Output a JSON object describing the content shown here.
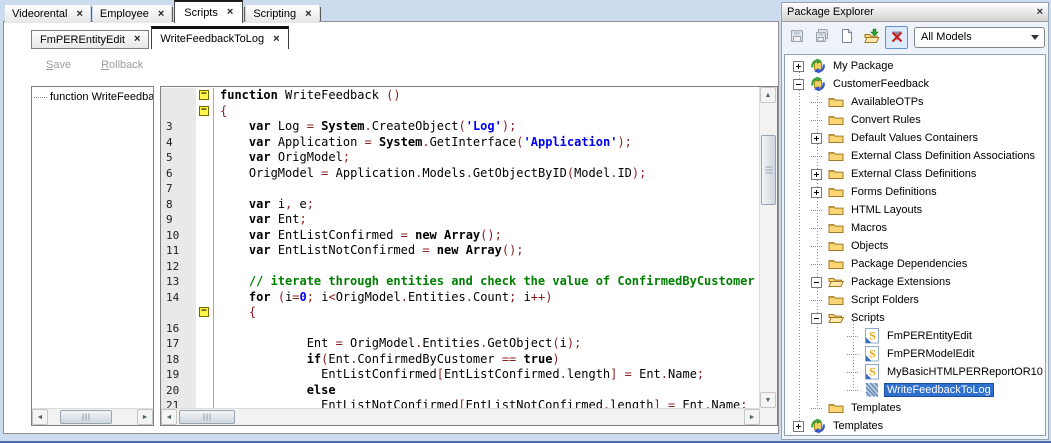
{
  "colors": {
    "selection_bg": "#2f6fce",
    "string": "#0000ee",
    "comment": "#008000",
    "symbol": "#8b2020",
    "number": "#0000ee"
  },
  "document_tabs": [
    {
      "label": "Videorental",
      "close": "×",
      "active": false
    },
    {
      "label": "Employee",
      "close": "×",
      "active": false
    },
    {
      "label": "Scripts",
      "close": "×",
      "active": true
    },
    {
      "label": "Scripting",
      "close": "×",
      "active": false
    }
  ],
  "editor_tabs": [
    {
      "label": "FmPEREntityEdit",
      "close": "×",
      "active": false
    },
    {
      "label": "WriteFeedbackToLog",
      "close": "×",
      "active": true
    }
  ],
  "toolbar": {
    "save_label": "Save",
    "rollback_label": "Rollback"
  },
  "outline": {
    "items": [
      {
        "label": "function WriteFeedback"
      }
    ]
  },
  "code_editor": {
    "lines": [
      {
        "num": "",
        "fold": "minus",
        "text": "function WriteFeedback ()"
      },
      {
        "num": "",
        "fold": "minus",
        "text": "{"
      },
      {
        "num": "3",
        "fold": "",
        "text": "    var Log = System.CreateObject('Log');"
      },
      {
        "num": "4",
        "fold": "",
        "text": "    var Application = System.GetInterface('Application');"
      },
      {
        "num": "5",
        "fold": "",
        "text": "    var OrigModel;"
      },
      {
        "num": "6",
        "fold": "",
        "text": "    OrigModel = Application.Models.GetObjectByID(Model.ID);"
      },
      {
        "num": "7",
        "fold": "",
        "text": ""
      },
      {
        "num": "8",
        "fold": "",
        "text": "    var i, e;"
      },
      {
        "num": "9",
        "fold": "",
        "text": "    var Ent;"
      },
      {
        "num": "10",
        "fold": "",
        "text": "    var EntListConfirmed = new Array();"
      },
      {
        "num": "11",
        "fold": "",
        "text": "    var EntListNotConfirmed = new Array();"
      },
      {
        "num": "12",
        "fold": "",
        "text": ""
      },
      {
        "num": "13",
        "fold": "",
        "text": "    // iterate through entities and check the value of ConfirmedByCustomer"
      },
      {
        "num": "14",
        "fold": "",
        "text": "    for (i=0; i<OrigModel.Entities.Count; i++)"
      },
      {
        "num": "",
        "fold": "minus",
        "text": "    {"
      },
      {
        "num": "16",
        "fold": "",
        "text": ""
      },
      {
        "num": "17",
        "fold": "",
        "text": "            Ent = OrigModel.Entities.GetObject(i);"
      },
      {
        "num": "18",
        "fold": "",
        "text": "            if(Ent.ConfirmedByCustomer == true)"
      },
      {
        "num": "19",
        "fold": "",
        "text": "              EntListConfirmed[EntListConfirmed.length] = Ent.Name;"
      },
      {
        "num": "20",
        "fold": "",
        "text": "            else"
      },
      {
        "num": "21",
        "fold": "",
        "text": "              EntListNotConfirmed[EntListNotConfirmed.length] = Ent.Name;"
      }
    ]
  },
  "package_explorer": {
    "title": "Package Explorer",
    "close": "×",
    "toolbar": {
      "buttons": [
        {
          "icon": "save",
          "name": "save-icon",
          "disabled": true,
          "pressed": false
        },
        {
          "icon": "save-all",
          "name": "save-all-icon",
          "disabled": true,
          "pressed": false
        },
        {
          "icon": "new-document",
          "name": "new-document-icon",
          "disabled": false,
          "pressed": false
        },
        {
          "icon": "open-package",
          "name": "open-package-icon",
          "disabled": false,
          "pressed": false
        },
        {
          "icon": "filter-disabled",
          "name": "filter-disabled-icon",
          "disabled": false,
          "pressed": true
        }
      ],
      "model_filter": {
        "value": "All Models"
      }
    },
    "tree": [
      {
        "label": "My Package",
        "icon": "package",
        "level": 0,
        "expander": "plus",
        "selected": false
      },
      {
        "label": "CustomerFeedback",
        "icon": "package",
        "level": 0,
        "expander": "minus",
        "selected": false
      },
      {
        "label": "AvailableOTPs",
        "icon": "folder",
        "level": 1,
        "expander": "",
        "selected": false
      },
      {
        "label": "Convert Rules",
        "icon": "folder",
        "level": 1,
        "expander": "",
        "selected": false
      },
      {
        "label": "Default Values Containers",
        "icon": "folder",
        "level": 1,
        "expander": "plus",
        "selected": false
      },
      {
        "label": "External Class Definition Associations",
        "icon": "folder",
        "level": 1,
        "expander": "",
        "selected": false
      },
      {
        "label": "External Class Definitions",
        "icon": "folder",
        "level": 1,
        "expander": "plus",
        "selected": false
      },
      {
        "label": "Forms Definitions",
        "icon": "folder",
        "level": 1,
        "expander": "plus",
        "selected": false
      },
      {
        "label": "HTML Layouts",
        "icon": "folder",
        "level": 1,
        "expander": "",
        "selected": false
      },
      {
        "label": "Macros",
        "icon": "folder",
        "level": 1,
        "expander": "",
        "selected": false
      },
      {
        "label": "Objects",
        "icon": "folder",
        "level": 1,
        "expander": "",
        "selected": false
      },
      {
        "label": "Package Dependencies",
        "icon": "folder",
        "level": 1,
        "expander": "",
        "selected": false
      },
      {
        "label": "Package Extensions",
        "icon": "folder-open",
        "level": 1,
        "expander": "minus",
        "selected": false
      },
      {
        "label": "Script Folders",
        "icon": "folder",
        "level": 1,
        "expander": "",
        "selected": false
      },
      {
        "label": "Scripts",
        "icon": "folder-open",
        "level": 1,
        "expander": "minus",
        "selected": false
      },
      {
        "label": "FmPEREntityEdit",
        "icon": "script",
        "level": 2,
        "expander": "",
        "selected": false
      },
      {
        "label": "FmPERModelEdit",
        "icon": "script",
        "level": 2,
        "expander": "",
        "selected": false
      },
      {
        "label": "MyBasicHTMLPERReportOR10",
        "icon": "script",
        "level": 2,
        "expander": "",
        "selected": false
      },
      {
        "label": "WriteFeedbackToLog",
        "icon": "script-open",
        "level": 2,
        "expander": "",
        "selected": true
      },
      {
        "label": "Templates",
        "icon": "folder",
        "level": 1,
        "expander": "",
        "selected": false
      },
      {
        "label": "Templates",
        "icon": "package",
        "level": 0,
        "expander": "plus",
        "selected": false
      }
    ]
  }
}
